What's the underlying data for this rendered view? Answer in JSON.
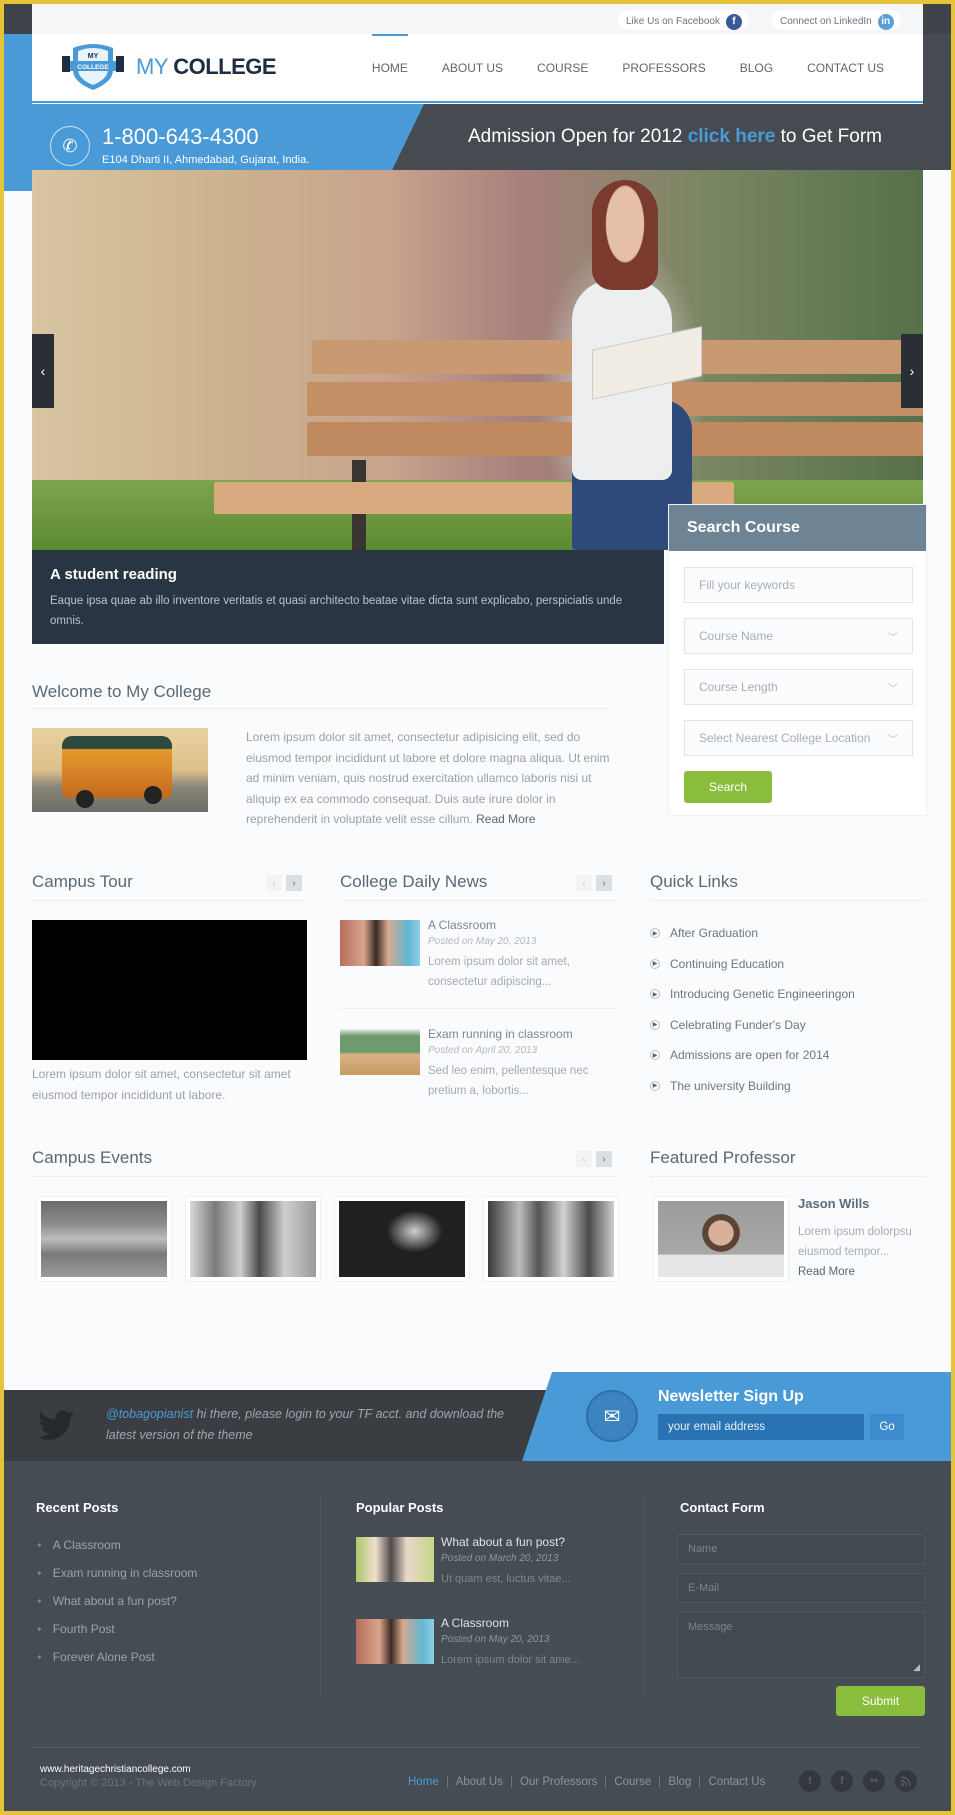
{
  "topbar": {
    "facebook_label": "Like Us on Facebook",
    "linkedin_label": "Connect on LinkedIn",
    "facebook_icon": "f",
    "linkedin_icon": "in"
  },
  "header": {
    "logo_badge_top": "MY",
    "logo_badge_bottom": "COLLEGE",
    "logo_light": "MY",
    "logo_bold": "COLLEGE",
    "nav": [
      {
        "label": "HOME",
        "active": true
      },
      {
        "label": "ABOUT US",
        "active": false
      },
      {
        "label": "COURSE",
        "active": false
      },
      {
        "label": "PROFESSORS",
        "active": false
      },
      {
        "label": "BLOG",
        "active": false
      },
      {
        "label": "CONTACT US",
        "active": false
      }
    ]
  },
  "infobar": {
    "phone": "1-800-643-4300",
    "address": "E104 Dharti II, Ahmedabad, Gujarat, India.",
    "admission_before": "Admission Open for 2012 ",
    "admission_link": "click here",
    "admission_after": " to Get Form"
  },
  "slider": {
    "prev": "‹",
    "next": "›",
    "caption_title": "A student reading",
    "caption_text": "Eaque ipsa quae ab illo inventore veritatis et quasi architecto beatae vitae dicta sunt explicabo, perspiciatis unde omnis."
  },
  "search_course": {
    "title": "Search Course",
    "keywords_placeholder": "Fill your keywords",
    "course_name": "Course Name",
    "course_length": "Course Length",
    "location": "Select Nearest College Location",
    "button": "Search"
  },
  "welcome": {
    "title": "Welcome to My College",
    "text": "Lorem ipsum dolor sit amet, consectetur adipisicing elit, sed do eiusmod tempor incididunt ut labore et dolore magna aliqua. Ut enim ad minim veniam, quis nostrud exercitation ullamco laboris nisi ut aliquip ex ea commodo consequat. Duis aute irure dolor in reprehenderit in voluptate velit esse cillum.",
    "read_more": "Read More"
  },
  "campus_tour": {
    "title": "Campus Tour",
    "text": "Lorem ipsum dolor sit amet, consectetur sit amet eiusmod tempor incididunt ut labore."
  },
  "daily_news": {
    "title": "College Daily News",
    "items": [
      {
        "title": "A Classroom",
        "date": "Posted on May 20, 2013",
        "text": "Lorem ipsum dolor sit amet, consectetur adipiscing..."
      },
      {
        "title": "Exam running in classroom",
        "date": "Posted on April 20, 2013",
        "text": "Sed leo enim, pellentesque nec pretium a, lobortis..."
      }
    ]
  },
  "quick_links": {
    "title": "Quick Links",
    "items": [
      "After Graduation",
      "Continuing Education",
      "Introducing Genetic Engineeringon",
      "Celebrating Funder's Day",
      "Admissions are open for 2014",
      "The university Building"
    ]
  },
  "campus_events": {
    "title": "Campus Events"
  },
  "featured_professor": {
    "title": "Featured Professor",
    "name": "Jason Wills",
    "text": "Lorem ipsum dolorpsu eiusmod tempor...",
    "read_more": "Read More"
  },
  "twitter": {
    "handle": "@tobagopianist",
    "text": " hi there, please login to your TF acct. and download the latest version of the theme"
  },
  "newsletter": {
    "title": "Newsletter Sign Up",
    "email_value": "your email address",
    "button": "Go"
  },
  "footer": {
    "recent_posts": {
      "title": "Recent Posts",
      "items": [
        "A Classroom",
        "Exam running in classroom",
        "What about a fun post?",
        "Fourth Post",
        "Forever Alone Post"
      ]
    },
    "popular_posts": {
      "title": "Popular Posts",
      "items": [
        {
          "title": "What about a fun post?",
          "date": "Posted on March 20, 2013",
          "text": "Ut quam est, luctus vitae..."
        },
        {
          "title": "A Classroom",
          "date": "Posted on May 20, 2013",
          "text": "Lorem ipsum dolor sit ame..."
        }
      ]
    },
    "contact_form": {
      "title": "Contact Form",
      "name_placeholder": "Name",
      "email_placeholder": "E-Mail",
      "message_placeholder": "Message",
      "submit": "Submit"
    },
    "watermark": "www.heritagechristiancollege.com",
    "copyright": "Copyright © 2013 - The Web Design Factory",
    "nav": [
      "Home",
      "About Us",
      "Our Professors",
      "Course",
      "Blog",
      "Contact Us"
    ],
    "social": [
      "t",
      "f",
      "••",
      "rss"
    ]
  },
  "colors": {
    "accent_blue": "#4a9ad8",
    "dark": "#464b52",
    "green": "#8bbd3c",
    "caption_bg": "#2a3544"
  }
}
